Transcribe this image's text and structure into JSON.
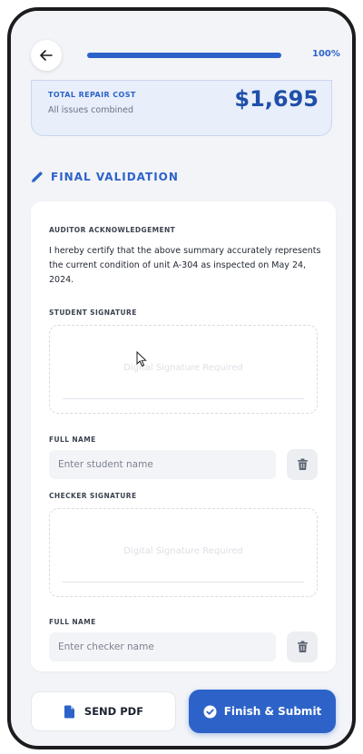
{
  "header": {
    "progress_percent": 100,
    "progress_label": "100%"
  },
  "cost": {
    "label": "TOTAL REPAIR COST",
    "sub": "All issues combined",
    "value": "$1,695"
  },
  "section": {
    "title": "FINAL VALIDATION"
  },
  "acknowledgement": {
    "label": "AUDITOR ACKNOWLEDGEMENT",
    "text": "I hereby certify that the above summary accurately represents the current condition of unit A-304 as inspected on May 24, 2024."
  },
  "student": {
    "signature_label": "STUDENT SIGNATURE",
    "signature_placeholder": "Digital Signature Required",
    "name_label": "FULL NAME",
    "name_placeholder": "Enter student name",
    "name_value": ""
  },
  "checker": {
    "signature_label": "CHECKER SIGNATURE",
    "signature_placeholder": "Digital Signature Required",
    "name_label": "FULL NAME",
    "name_placeholder": "Enter checker name",
    "name_value": ""
  },
  "actions": {
    "send_pdf": "SEND PDF",
    "submit": "Finish & Submit"
  },
  "colors": {
    "accent": "#2d63c8",
    "cost_value": "#1f4fa8"
  },
  "icons": {
    "back": "arrow-left-icon",
    "section": "pencil-icon",
    "trash": "trash-icon",
    "pdf": "file-icon",
    "submit": "check-circle-icon"
  }
}
